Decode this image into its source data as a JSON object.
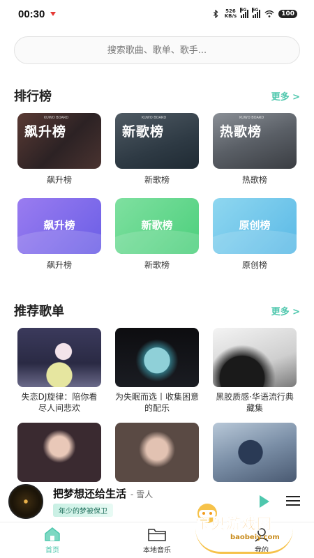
{
  "status_bar": {
    "time": "00:30",
    "net_speed_value": "526",
    "net_speed_unit": "KB/s",
    "signal_1": "5G",
    "signal_2": "5G",
    "battery": "100"
  },
  "search": {
    "placeholder": "搜索歌曲、歌单、歌手..."
  },
  "charts_section": {
    "title": "排行榜",
    "more": "更多 >",
    "cards": [
      {
        "cover_text": "飙升榜",
        "sub": "KUWO BOARD",
        "label": "飙升榜"
      },
      {
        "cover_text": "新歌榜",
        "sub": "KUWO BOARD",
        "label": "新歌榜"
      },
      {
        "cover_text": "热歌榜",
        "sub": "KUWO BOARD",
        "label": "热歌榜"
      },
      {
        "cover_text": "飙升榜",
        "label": "飙升榜"
      },
      {
        "cover_text": "新歌榜",
        "label": "新歌榜"
      },
      {
        "cover_text": "原创榜",
        "label": "原创榜"
      }
    ]
  },
  "playlist_section": {
    "title": "推荐歌单",
    "more": "更多 >",
    "playlists": [
      {
        "name": "失恋DJ旋律：陪你看尽人间悲欢"
      },
      {
        "name": "为失眠而选丨收集困意的配乐"
      },
      {
        "name": "黑胶质感·华语流行典藏集"
      },
      {
        "name": ""
      },
      {
        "name": ""
      },
      {
        "name": ""
      }
    ]
  },
  "player": {
    "title": "把梦想还给生活",
    "artist": "- 雪人",
    "lyric": "年少的梦被保卫"
  },
  "nav": {
    "items": [
      {
        "label": "首页",
        "active": true
      },
      {
        "label": "本地音乐",
        "active": false
      },
      {
        "label": "我的",
        "active": false
      }
    ]
  },
  "watermark": {
    "text": "宝贝游戏网",
    "url": "baobeiy.com"
  },
  "colors": {
    "accent": "#4ec7ad"
  }
}
